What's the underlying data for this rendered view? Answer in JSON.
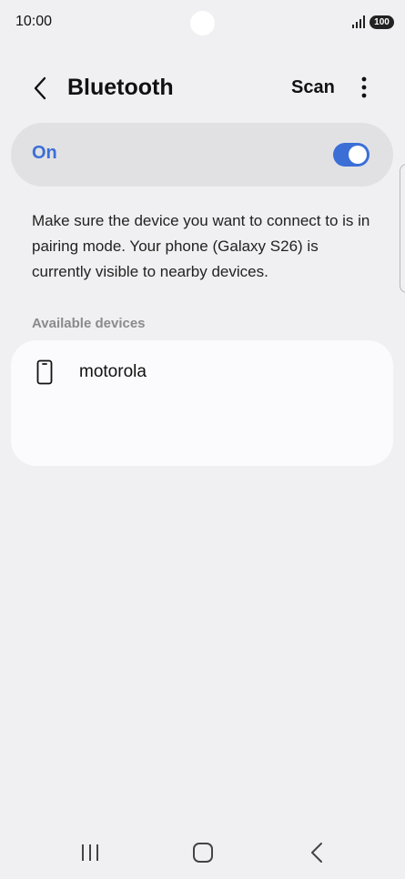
{
  "status_bar": {
    "time": "10:00",
    "battery": "100",
    "icons": [
      "signal-icon",
      "battery-icon"
    ]
  },
  "app_bar": {
    "title": "Bluetooth",
    "scan_label": "Scan",
    "icons": [
      "back-arrow-icon",
      "more-vertical-icon"
    ]
  },
  "bluetooth_toggle": {
    "label": "On",
    "state": "on",
    "accent_color": "#3b6fd6"
  },
  "description": "Make sure the device you want to connect to is in pairing mode. Your phone (Galaxy S26) is currently visible to nearby devices.",
  "available_devices": {
    "header": "Available devices",
    "items": [
      {
        "name": "motorola",
        "icon": "phone-icon"
      }
    ]
  },
  "nav_bar": {
    "icons": [
      "recents-icon",
      "home-icon",
      "back-icon"
    ]
  }
}
